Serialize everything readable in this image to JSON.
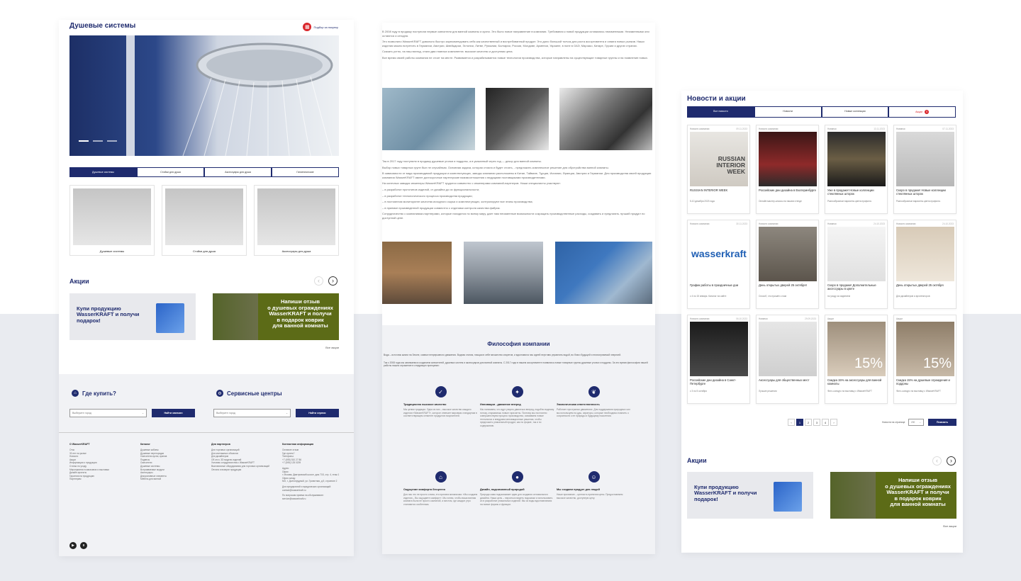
{
  "colors": {
    "brand": "#1f2b6e",
    "accent_red": "#d9262b",
    "promo_green": "#5c6b17"
  },
  "p1": {
    "title": "Душевые системы",
    "order_link": "Подбор за покупку",
    "tabs": [
      "Душевые системы",
      "Стойки для душа",
      "Аксессуары для душа",
      "Гигиенические"
    ],
    "cards": [
      "Душевые системы",
      "Стойки для душа",
      "Аксессуары для душа"
    ],
    "promo_title": "Акции",
    "promo1": "Купи продукцию WasserKRAFT и получи подарок!",
    "promo2": [
      "Напиши отзыв",
      "о душевых ограждениях",
      "WasserKRAFT и получи",
      "в подарок коврик",
      "для ванной комнаты"
    ],
    "all_promos": "Все акции",
    "where_title": "Где купить?",
    "service_title": "Сервисные центры",
    "city_placeholder": "Выберите город",
    "find_store": "Найти магазин",
    "find_service": "Найти сервис",
    "footer": {
      "cols": [
        {
          "head": "О WasserKRAFT",
          "items": [
            "Отзо",
            "30 лет на рынке",
            "Новости",
            "Акции",
            "Информация о продукции",
            "Статьи по уходу",
            "Мероприятия в магазинах и выставки",
            "Дизайн-проекты",
            "Гарантия на продукцию",
            "Партнерам"
          ]
        },
        {
          "head": "Каталог",
          "items": [
            "Душевые кабины",
            "Душевые перегородки",
            "Смесители кухни, кранов",
            "Подвесы",
            "Смесители",
            "Душевые системы",
            "Встраиваемые модули",
            "Аксессуары",
            "Декоративные элементы",
            "Мебель для ванной"
          ]
        },
        {
          "head": "Для партнеров",
          "items": [
            "Для торговых организаций",
            "Для монтажных объектов",
            "Для дизайнеров",
            "Об отсч. 3D модели изделий",
            "Условия сотрудничества с WasserKRAFT",
            "Выставочные оборудования для торговых организаций",
            "Оплата и возврат продукции"
          ]
        },
        {
          "head": "Контактная информация",
          "items": [
            "Оставьте отзыв",
            "Где купить?",
            "Телефоны:",
            "+7 (495) 510 27 86",
            "+7 (495) 125 0209",
            "",
            "Адрес:",
            "Офис:",
            "г. Москва, Дмитровский шоссе, дом 71Б, стр. 4, этаж 1",
            "Офис склад:",
            "МО, г. Долгопрудный, ул. Гранитная, д.9, строение 2",
            "",
            "Для предприятий и юридических организаций:",
            "contact@wasserkraft.ru",
            "",
            "По вопросам приема на обслуживание:",
            "service@wasserkraft.ru"
          ]
        }
      ]
    }
  },
  "p2": {
    "para1": [
      "В 2008 году в продажу поступили первые смесители для ванной комнаты и кухни. Это было новое направление в компании. Требования к новой продукции оставались неизменными. Неизменными они остаются и сегодня.",
      "Это позволило WasserKRAFT довольно быстро зарекомендовать себя как качественный и востребованный продукт. Это дало большой толчок для роста ассортимента и охвата новых рынков. Наши изделия можно встретить в Германии, Австрии, Швейцарии, Эстонии, Литве, Румынии, Болгарии, России, Молдове, Армении, Украине, в поне в ОАЭ, Марокко, Катаре, Грузии и других странах.",
      "Сказать устно, на наш взгляд, стали два главных компонента: высокое качество и доступная цена.",
      "Все время своей работы компания не стоит на месте. Развивается и разрабатывается новые технологии производства, которые направлены на существующие товарные группы и на появление новых."
    ],
    "para2": [
      "Так в 2017 году поступили в продажу душевые уголки и поддоны, а в указанный через год — декор для ванной комнаты.",
      "Выбор новых товарных групп был не случайным. Основная задача, которая стояла и будет стоять, - предложить комплексное решение для обустройства ванной комнаты.",
      "В зависимости от вида производимой продукции и комплектующих, заводы компании расположены в Китае, Тайване, Турции, Испании, Франции, Австрии и Германии. Для производства своей продукции компания WasserKRAFT имеет долгосрочные партнерские взаимоотношения с ведущими поставщиками производителями.",
      "На конечных заводах инженеры WasserKRAFT трудятся совместно с инженерами компаний-партнеров. Наши специалисты участвуют:",
      "– в разработке прототипов изделий, от дизайна до их функциональности;",
      "– в разработке технологического процесса производства продукции;",
      "– в постоянном мониторинге качества исходного сырья и комплектующих, контролируют все этапы производства;",
      "– в приемке произведенной продукции совместно с отделами контроля качества фабрик.",
      "Сотрудничество с компаниями-партнерами, которые находятся по всему миру, дает нам неизменные возможности сокращать производственные расходы, создавать и предлагать лучший продукт по доступной цене."
    ],
    "phil_title": "Философия компании",
    "phil_text": [
      "Вода – источник жизни на Земле, символ непрерывного движения. Водная стихия, таящая в себе множество секретов, и вдохновила нас идеей неучтиво управлять водой, во благо будущей и неисчерпаемой энергией.",
      "Так с 2008 года мы занимаемся созданием смесителей, душевых систем и аксессуаров для ванной комнаты. С 2017 года в нашем ассортименте появились новые товарные группы душевые уголки и поддоны. За это время философия нашей работы нашла отражение в следующих принципах:"
    ],
    "values": [
      {
        "h": "Традиционно высокое качество",
        "t": "Мы ценим традиции. Одна из них – высокое качество каждого изделия «WasserKRAFT», которое отвечает мировым стандартам в соответствующем сегменте продуктов покупателей."
      },
      {
        "h": "Инновации - движение вперед",
        "t": "Мы понимаем, что идут упорно двигаться вперед, подобно водному потоку, открываешь новые горизонты. Поэтому мы постоянно совершенствуем процесс производства, осваиваем новые технологии и внедряем инновационные решения, чтобы предложить уникальный продукт, как по форме, так и по содержанию."
      },
      {
        "h": "Экологическая ответственность",
        "t": "Работает при нужных движениях. Для поддержания природных сил мы используем на душ, аэраторы, которые необходимо помнить о сохранности к ее природы и будущему поколения."
      },
      {
        "h": "Ощущение комфорта бесценно",
        "t": "Для нас это не просто слова, это причина механизма: «Мы создаем изделия – Вы ощущаете комфорт». Мы хотим, чтобы ваша ванная комната была не просто комнатой, а местом, где каждое утро становится особенным."
      },
      {
        "h": "Дизайн, подсказанный природой",
        "t": "Природа сама подсказывает идеи для создания оптимального дизайна. Наша цель – научиться видеть подсказки и использовать их в разработке уникальных изделий. Мы из воды вдохновляемся на новые формы и функции."
      },
      {
        "h": "Мы создаем продукт для людей",
        "t": "Наше признание – ценность принятия цены. Предоставляем высокое качество, доступную цену."
      }
    ]
  },
  "p3": {
    "title": "Новости и акции",
    "filters": [
      "Все новости",
      "Новости",
      "Новые коллекции",
      "Акции"
    ],
    "filter_badge": "5",
    "news": [
      {
        "tag": "Новости компании",
        "date": "09.11.2023",
        "title": "RUSSIAN INTERIOR WEEK",
        "sub": "5-10 декабря 2023 года"
      },
      {
        "tag": "Новости компании",
        "date": "",
        "title": "Российские дни дизайна в Екатеринбурге",
        "sub": "Онлайн мастер-классы на нашем стенде"
      },
      {
        "tag": "Новинки",
        "date": "13.11.2023",
        "title": "Уже в продаже! Новые коллекции стеклянных шторок",
        "sub": "Разнообразные варианты цвета профиля."
      },
      {
        "tag": "Новинки",
        "date": "07.11.2023",
        "title": "Скоро в продаже! Новые коллекции стеклянных шторок",
        "sub": "Разнообразные варианты цвета профиля."
      },
      {
        "tag": "Новости компании",
        "date": "30.11.2023",
        "title": "График работы в праздничные дни",
        "sub": "c 4 по 15 января. Каталог на сайте"
      },
      {
        "tag": "Новости компании",
        "date": "",
        "title": "День открытых дверей 25 октября!",
        "sub": "Способ, что пришёл к нам"
      },
      {
        "tag": "Новинки",
        "date": "24.10.2023",
        "title": "Скоро в продаже! Дополнительные аксессуары в цвете",
        "sub": "по уходу за изделием"
      },
      {
        "tag": "Новости компании",
        "date": "24.10.2023",
        "title": "День открытых дверей 25 октября",
        "sub": "Для дизайнеров и архитекторов"
      },
      {
        "tag": "Новости компании",
        "date": "06.10.2023",
        "title": "Российские дни дизайна в Санкт-Петербурге",
        "sub": "с 3 по 5 октября"
      },
      {
        "tag": "Новинки",
        "date": "29.09.2023",
        "title": "Аксессуары для общественных мест",
        "sub": "Лучшие решения"
      },
      {
        "tag": "Акции",
        "date": "",
        "title": "Скидка 15% на аксессуары для ванной комнаты",
        "sub": "Фото-конкурс на выставку с WasserKRAFT"
      },
      {
        "tag": "Акции",
        "date": "",
        "title": "Скидка 15% на душевые ограждения и поддоны",
        "sub": "Фото-конкурс на выставку с WasserKRAFT"
      }
    ],
    "pages": [
      "‹",
      "1",
      "2",
      "3",
      "4",
      "›"
    ],
    "per_page_label": "Новости на странице",
    "per_page_value": "200",
    "show_btn": "Показать",
    "promo_title": "Акции",
    "all_promos": "Все акции",
    "wk_logo": "wasserkraft",
    "riw": [
      "RUSSIAN",
      "INTERIOR",
      "WEEK"
    ],
    "sale": "15%"
  }
}
